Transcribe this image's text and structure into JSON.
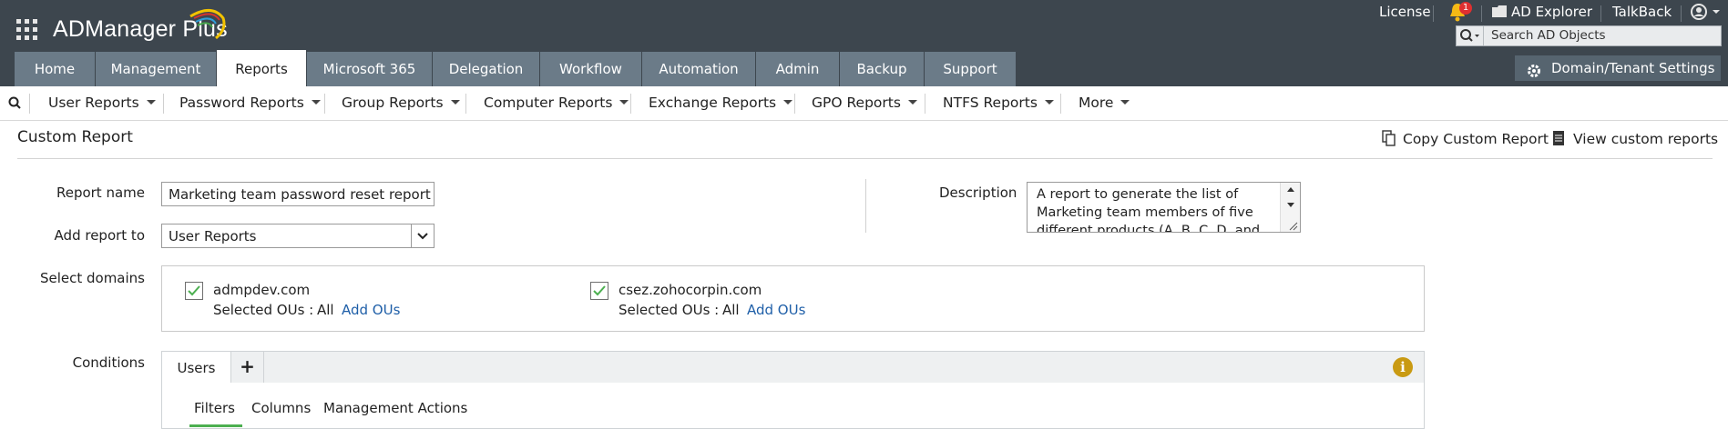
{
  "app": {
    "title": "ADManager Plus"
  },
  "header_links": {
    "license": "License",
    "notifications_count": "1",
    "ad_explorer": "AD Explorer",
    "talkback": "TalkBack"
  },
  "search": {
    "placeholder": "Search AD Objects"
  },
  "tabs": [
    {
      "label": "Home"
    },
    {
      "label": "Management"
    },
    {
      "label": "Reports"
    },
    {
      "label": "Microsoft 365"
    },
    {
      "label": "Delegation"
    },
    {
      "label": "Workflow"
    },
    {
      "label": "Automation"
    },
    {
      "label": "Admin"
    },
    {
      "label": "Backup"
    },
    {
      "label": "Support"
    }
  ],
  "domain_settings": {
    "label": "Domain/Tenant Settings"
  },
  "subnav": [
    {
      "label": "User Reports"
    },
    {
      "label": "Password Reports"
    },
    {
      "label": "Group Reports"
    },
    {
      "label": "Computer Reports"
    },
    {
      "label": "Exchange Reports"
    },
    {
      "label": "GPO Reports"
    },
    {
      "label": "NTFS Reports"
    },
    {
      "label": "More"
    }
  ],
  "page": {
    "title": "Custom Report",
    "copy_link": "Copy Custom Report",
    "view_link": "View custom reports"
  },
  "form": {
    "report_name_label": "Report name",
    "report_name_value": "Marketing team password reset report",
    "add_report_label": "Add report to",
    "add_report_value": "User Reports",
    "description_label": "Description",
    "description_value": "A report to generate the list of Marketing team members of five different products (A, B, C, D, and E)",
    "select_domains_label": "Select domains",
    "domains": [
      {
        "name": "admpdev.com",
        "ou_label": "Selected OUs :",
        "ou_value": "All",
        "add_ous": "Add OUs"
      },
      {
        "name": "csez.zohocorpin.com",
        "ou_label": "Selected OUs :",
        "ou_value": "All",
        "add_ous": "Add OUs"
      }
    ],
    "conditions_label": "Conditions"
  },
  "conditions": {
    "tab": "Users",
    "add_tab": "+",
    "info": "i",
    "subtabs": [
      {
        "label": "Filters"
      },
      {
        "label": "Columns"
      },
      {
        "label": "Management Actions"
      }
    ]
  },
  "colors": {
    "topbar": "#3d464e",
    "tab": "#6b7b88",
    "link": "#1f5fa8",
    "check": "#4caf50",
    "info": "#c99a12",
    "bell": "#f5b915",
    "badge": "#e03030"
  },
  "icons": [
    "apps-grid-icon",
    "bell-icon",
    "folder-icon",
    "user-icon",
    "search-icon",
    "gear-icon",
    "copy-icon",
    "document-icon",
    "checkmark-icon",
    "info-icon"
  ]
}
